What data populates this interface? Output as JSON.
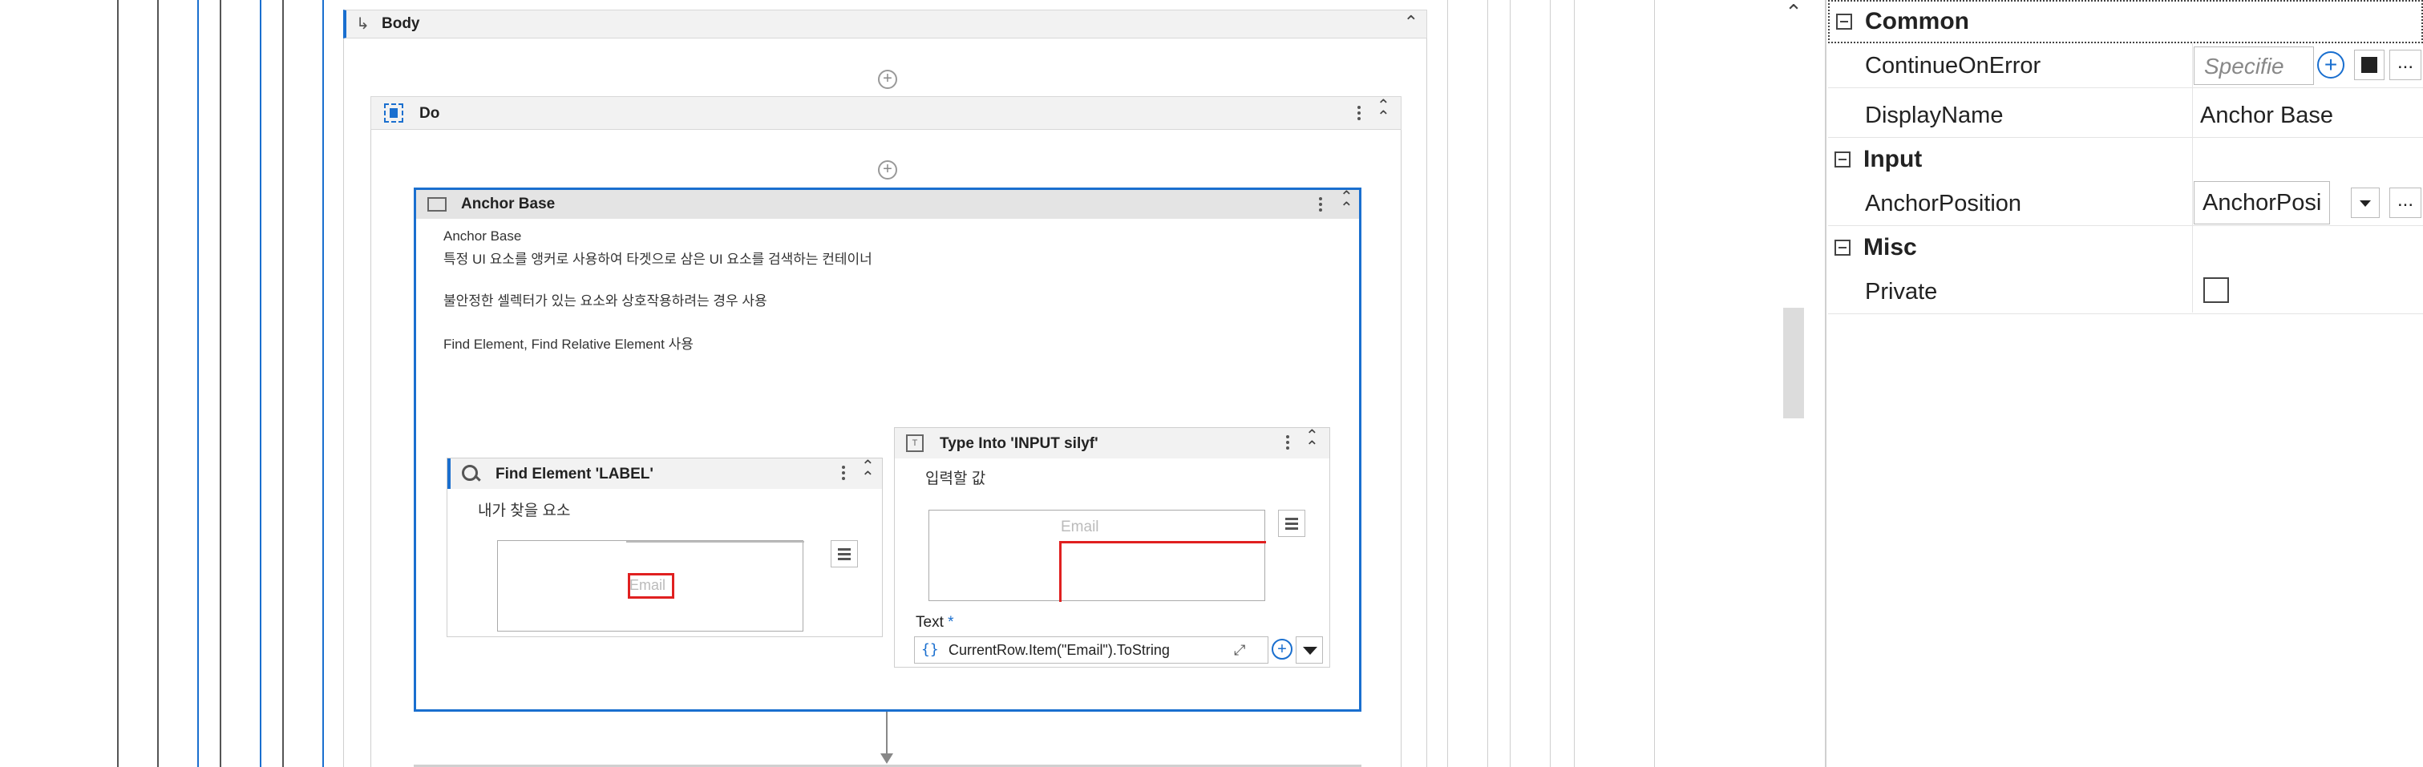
{
  "designer": {
    "body_header": {
      "label": "Body"
    },
    "do_header": {
      "label": "Do"
    },
    "anchor_base": {
      "title": "Anchor Base",
      "annotation_lines": [
        "Anchor Base",
        "특정 UI 요소를 앵커로 사용하여 타겟으로 삼은 UI 요소를 검색하는 컨테이너",
        "불안정한 셀렉터가 있는 요소와 상호작용하려는 경우 사용",
        "Find Element, Find Relative Element 사용"
      ]
    },
    "find_element": {
      "title": "Find Element 'LABEL'",
      "annotation": "내가 찾을 요소",
      "preview_text": "Email"
    },
    "type_into": {
      "title": "Type Into 'INPUT  silyf'",
      "annotation": "입력할 값",
      "preview_text": "Email",
      "text_label": "Text",
      "required_mark": "*",
      "expr_prefix": "{}",
      "expression": "CurrentRow.Item(\"Email\").ToString"
    }
  },
  "properties": {
    "categories": {
      "common": "Common",
      "input": "Input",
      "misc": "Misc"
    },
    "rows": {
      "continue_on_error": {
        "label": "ContinueOnError",
        "placeholder": "Specifie"
      },
      "display_name": {
        "label": "DisplayName",
        "value": "Anchor Base"
      },
      "anchor_position": {
        "label": "AnchorPosition",
        "value": "AnchorPosi"
      },
      "private": {
        "label": "Private"
      }
    },
    "more_button": "..."
  },
  "colors": {
    "accent": "#1a6fcf",
    "selection_red": "#e02020",
    "header_bg": "#e8e8e8"
  }
}
